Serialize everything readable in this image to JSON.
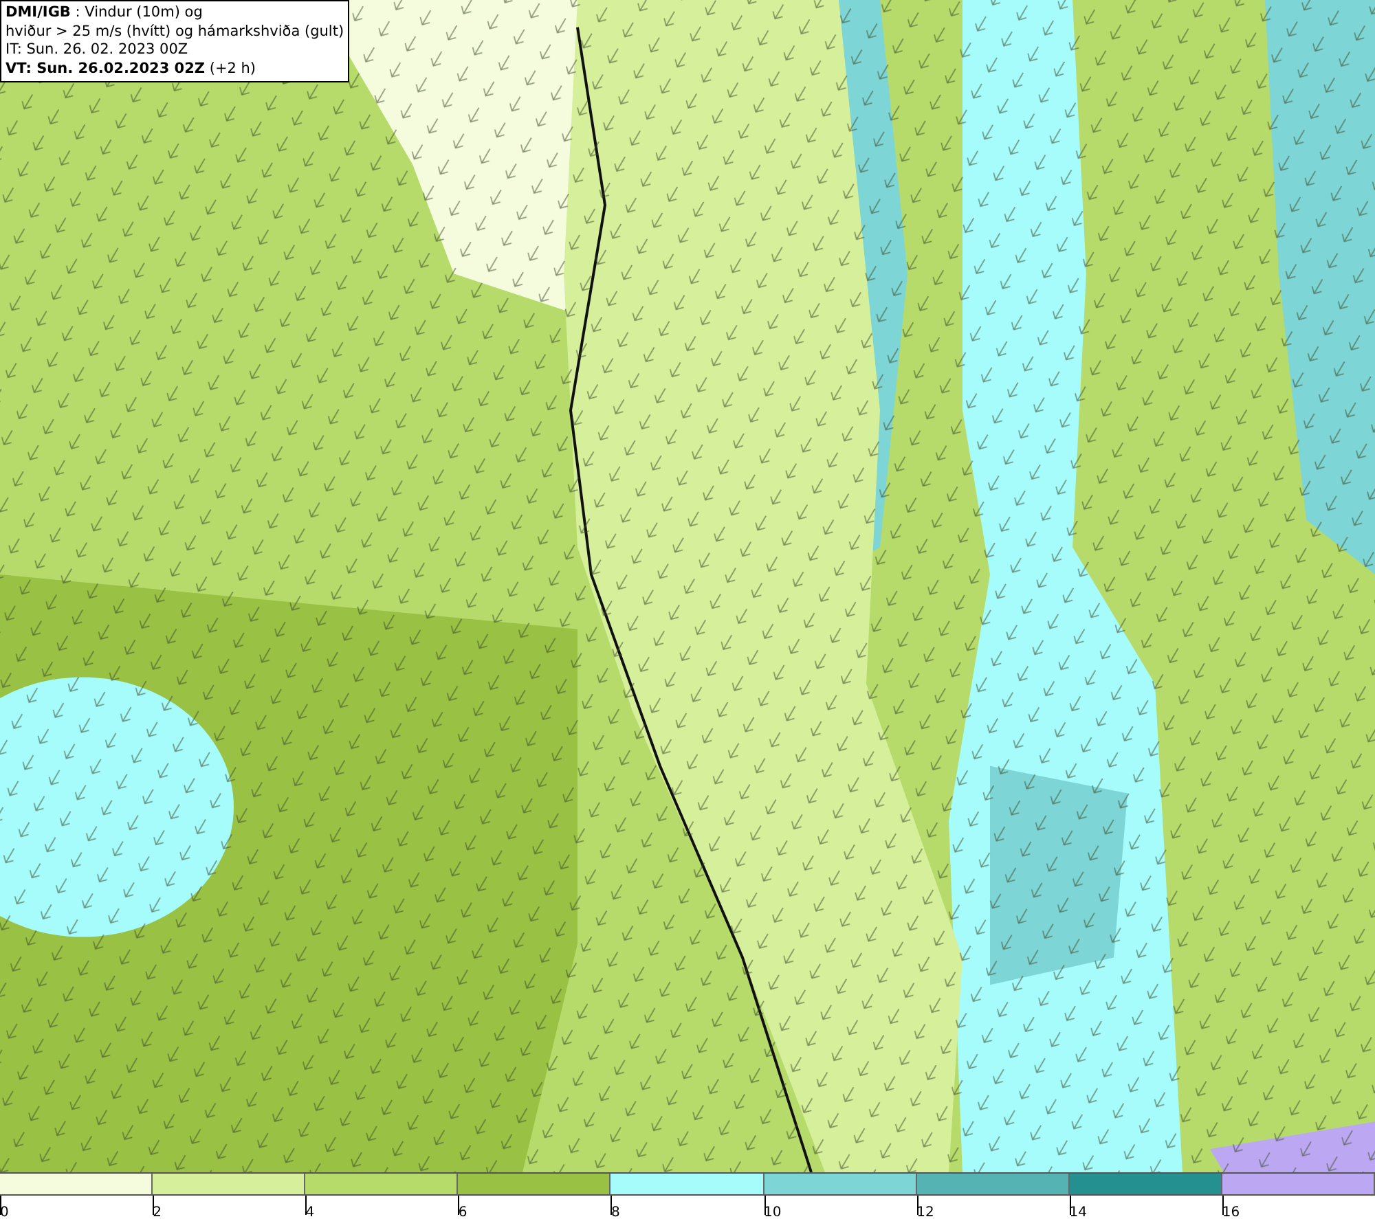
{
  "legend": {
    "lines": [
      "**DMI/IGB** : Vindur (10m) og",
      "hviður > 25 m/s (hvítt) og hámarkshviða (gult)",
      "IT: Sun. 26. 02. 2023 00Z",
      "**VT: Sun. 26.02.2023 02Z** (+2 h)"
    ]
  },
  "colorbar": {
    "segments": [
      {
        "color": "#f5fcde"
      },
      {
        "color": "#d6ef9a"
      },
      {
        "color": "#b6db6a"
      },
      {
        "color": "#99c144"
      },
      {
        "color": "#a6fbfb"
      },
      {
        "color": "#7ed5d5"
      },
      {
        "color": "#55b3b3"
      },
      {
        "color": "#249090"
      },
      {
        "color": "#bca8f2"
      }
    ],
    "ticks": [
      "0",
      "2",
      "4",
      "6",
      "8",
      "10",
      "12",
      "14",
      "16"
    ]
  }
}
